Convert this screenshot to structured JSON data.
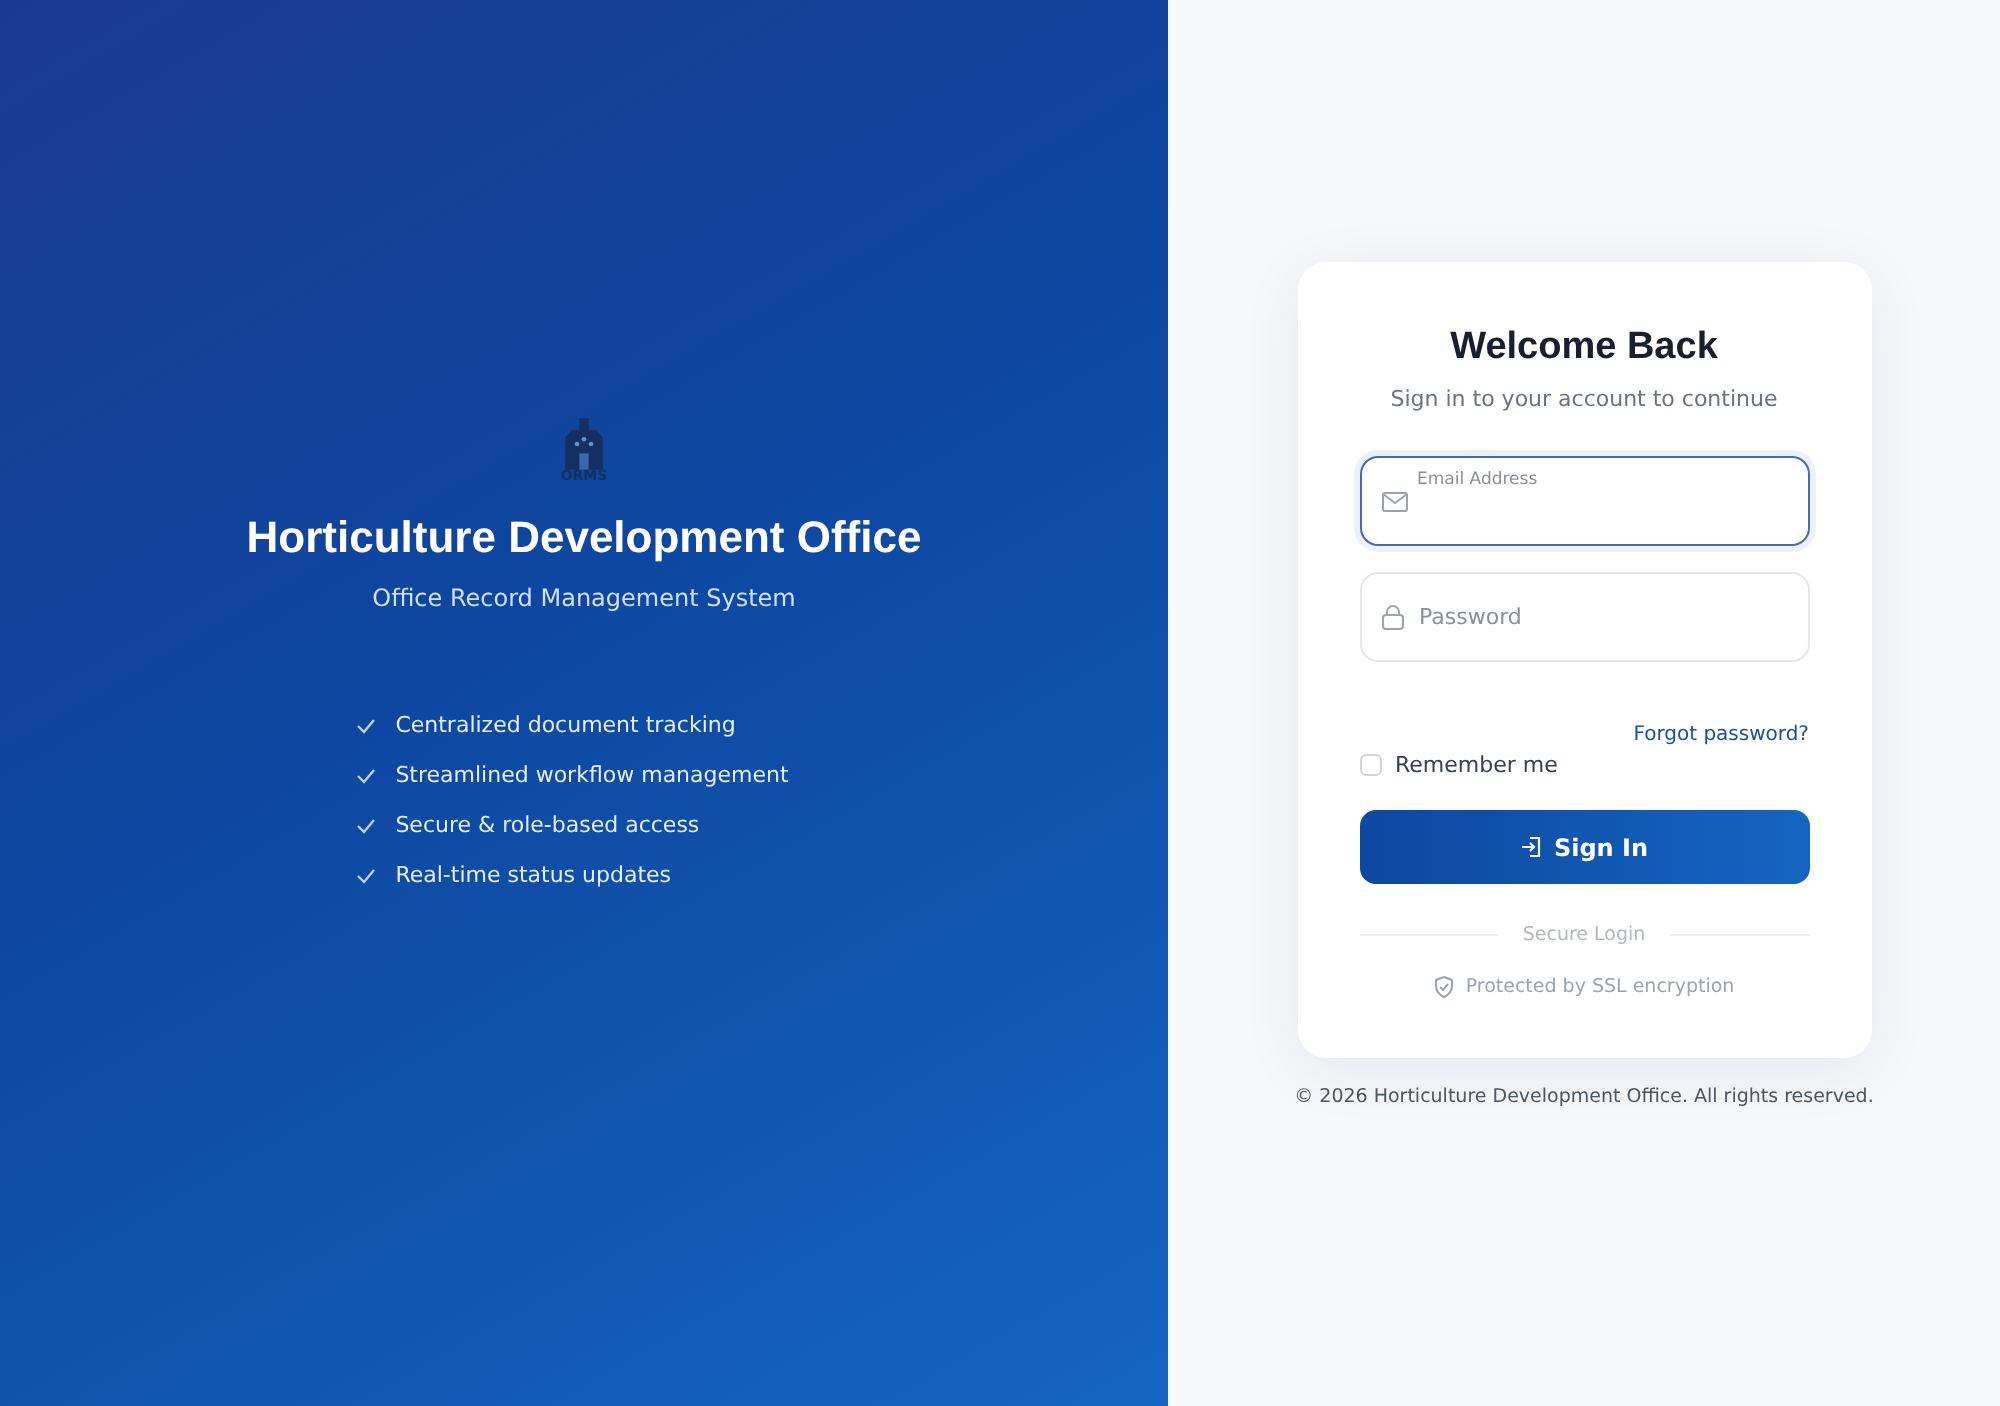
{
  "brand": {
    "logo_text": "ORMS",
    "title": "Horticulture Development Office",
    "subtitle": "Office Record Management System"
  },
  "features": [
    "Centralized document tracking",
    "Streamlined workflow management",
    "Secure & role-based access",
    "Real-time status updates"
  ],
  "login": {
    "title": "Welcome Back",
    "subtitle": "Sign in to your account to continue",
    "fields": [
      {
        "kind": "email",
        "label": "Email Address",
        "focused": true
      },
      {
        "kind": "password",
        "label": "Password",
        "focused": false
      }
    ],
    "remember": {
      "label": "Remember me",
      "checked": false
    },
    "forgot": "Forgot password?",
    "submit": "Sign In",
    "divider": "Secure Login",
    "note": "Protected by SSL encryption"
  },
  "footer": "© 2026 Horticulture Development Office. All rights reserved."
}
